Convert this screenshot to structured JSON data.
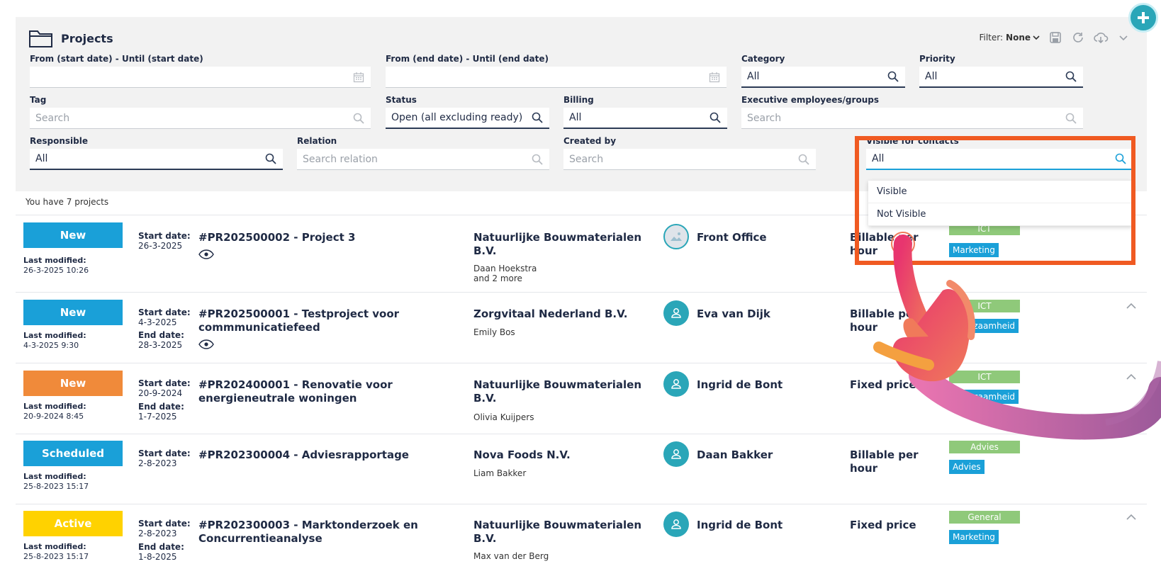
{
  "header": {
    "title": "Projects",
    "filter_label": "Filter:",
    "filter_value": "None"
  },
  "filters": {
    "start_date": {
      "label": "From (start date) - Until (start date)",
      "value": ""
    },
    "end_date": {
      "label": "From (end date) - Until (end date)",
      "value": ""
    },
    "category": {
      "label": "Category",
      "value": "All"
    },
    "priority": {
      "label": "Priority",
      "value": "All"
    },
    "tag": {
      "label": "Tag",
      "placeholder": "Search"
    },
    "status": {
      "label": "Status",
      "value": "Open (all excluding ready)"
    },
    "billing": {
      "label": "Billing",
      "value": "All"
    },
    "executive": {
      "label": "Executive employees/groups",
      "placeholder": "Search"
    },
    "responsible": {
      "label": "Responsible",
      "value": "All"
    },
    "relation": {
      "label": "Relation",
      "placeholder": "Search relation"
    },
    "created_by": {
      "label": "Created by",
      "placeholder": "Search"
    },
    "visible_for_contacts": {
      "label": "Visible for contacts",
      "value": "All",
      "options": [
        "Visible",
        "Not Visible"
      ]
    }
  },
  "count_text": "You have 7 projects",
  "labels": {
    "last_modified": "Last modified:",
    "start_date": "Start date:",
    "end_date": "End date:"
  },
  "projects": [
    {
      "status": "New",
      "status_color": "#1aa0d8",
      "last_modified": "26-3-2025 10:26",
      "start": "26-3-2025",
      "title": "#PR202500002 - Project 3",
      "relation": "Natuurlijke Bouwmaterialen B.V.",
      "contact": "Daan Hoekstra",
      "contact_extra": "and 2 more",
      "responsible": "Front Office",
      "billing": "Billable per hour",
      "category": "ICT",
      "tag": "Marketing"
    },
    {
      "status": "New",
      "status_color": "#1aa0d8",
      "last_modified": "4-3-2025 9:30",
      "start": "4-3-2025",
      "end": "28-3-2025",
      "title": "#PR202500001 - Testproject voor commmunicatiefeed",
      "relation": "Zorgvitaal Nederland B.V.",
      "contact": "Emily Bos",
      "responsible": "Eva van Dijk",
      "billing": "Billable per hour",
      "category": "ICT",
      "tag": "Duurzaamheid"
    },
    {
      "status": "New",
      "status_color": "#f08a3a",
      "last_modified": "20-9-2024 8:45",
      "start": "20-9-2024",
      "end": "1-7-2025",
      "title": "#PR202400001 - Renovatie voor energieneutrale woningen",
      "relation": "Natuurlijke Bouwmaterialen B.V.",
      "contact": "Olivia Kuijpers",
      "responsible": "Ingrid de Bont",
      "billing": "Fixed price",
      "category": "ICT",
      "tag": "Duurzaamheid"
    },
    {
      "status": "Scheduled",
      "status_color": "#1aa0d8",
      "last_modified": "25-8-2023 15:17",
      "start": "2-8-2023",
      "title": "#PR202300004 - Adviesrapportage",
      "relation": "Nova Foods N.V.",
      "contact": "Liam Bakker",
      "responsible": "Daan Bakker",
      "billing": "Billable per hour",
      "category": "Advies",
      "tag": "Advies"
    },
    {
      "status": "Active",
      "status_color": "#ffd200",
      "last_modified": "25-8-2023 15:17",
      "start": "2-8-2023",
      "end": "1-8-2025",
      "title": "#PR202300003 - Marktonderzoek en Concurrentieanalyse",
      "relation": "Natuurlijke Bouwmaterialen B.V.",
      "contact": "Max van der Berg",
      "responsible": "Ingrid de Bont",
      "billing": "Fixed price",
      "category": "General",
      "tag": "Marketing"
    }
  ],
  "colors": {
    "accent": "#1aa0d8",
    "highlight": "#f05a22",
    "category_tag": "#8fc97a",
    "avatar": "#2aa6b8"
  },
  "icons": [
    "folder-icon",
    "calendar-icon",
    "search-icon",
    "save-icon",
    "refresh-icon",
    "cloud-download-icon",
    "chevron-down-icon",
    "eye-icon",
    "user-icon",
    "chevron-up-icon",
    "plus-icon",
    "hand-pointer-icon"
  ]
}
